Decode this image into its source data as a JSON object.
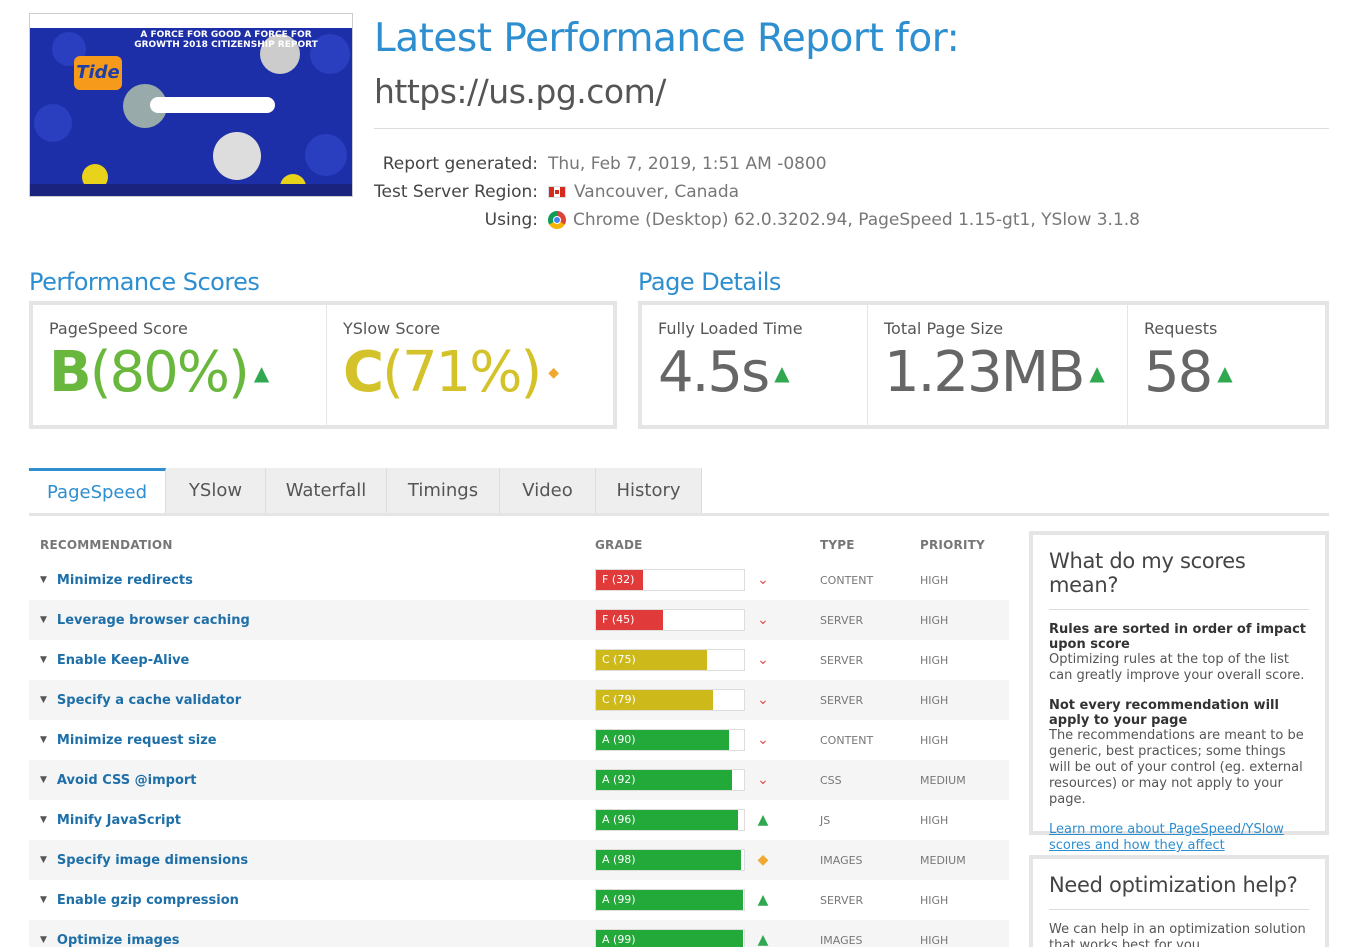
{
  "header": {
    "title": "Latest Performance Report for:",
    "url": "https://us.pg.com/",
    "meta": [
      {
        "label": "Report generated:",
        "value": "Thu, Feb 7, 2019, 1:51 AM -0800",
        "icon": ""
      },
      {
        "label": "Test Server Region:",
        "value": "Vancouver, Canada",
        "icon": "canada-flag-icon"
      },
      {
        "label": "Using:",
        "value": "Chrome (Desktop) 62.0.3202.94, PageSpeed 1.15-gt1, YSlow 3.1.8",
        "icon": "chrome-icon"
      }
    ],
    "thumbnail_text": "A FORCE FOR GOOD A FORCE FOR GROWTH 2018 CITIZENSHIP REPORT",
    "thumbnail_brand": "Tide"
  },
  "performance": {
    "title": "Performance Scores",
    "pagespeed": {
      "label": "PageSpeed Score",
      "grade": "B",
      "percent": "(80%)",
      "trend": "up"
    },
    "yslow": {
      "label": "YSlow Score",
      "grade": "C",
      "percent": "(71%)",
      "trend": "neutral"
    }
  },
  "details": {
    "title": "Page Details",
    "loaded": {
      "label": "Fully Loaded Time",
      "value": "4.5s"
    },
    "size": {
      "label": "Total Page Size",
      "value": "1.23MB"
    },
    "requests": {
      "label": "Requests",
      "value": "58"
    }
  },
  "tabs": [
    "PageSpeed",
    "YSlow",
    "Waterfall",
    "Timings",
    "Video",
    "History"
  ],
  "table": {
    "headers": {
      "rec": "RECOMMENDATION",
      "grade": "GRADE",
      "type": "TYPE",
      "priority": "PRIORITY"
    },
    "rows": [
      {
        "name": "Minimize redirects",
        "grade": "F (32)",
        "score": 32,
        "color": "#e03a3a",
        "trend": "down",
        "type": "CONTENT",
        "priority": "HIGH"
      },
      {
        "name": "Leverage browser caching",
        "grade": "F (45)",
        "score": 45,
        "color": "#e03a3a",
        "trend": "down",
        "type": "SERVER",
        "priority": "HIGH"
      },
      {
        "name": "Enable Keep-Alive",
        "grade": "C (75)",
        "score": 75,
        "color": "#cdb91a",
        "trend": "down",
        "type": "SERVER",
        "priority": "HIGH"
      },
      {
        "name": "Specify a cache validator",
        "grade": "C (79)",
        "score": 79,
        "color": "#cdb91a",
        "trend": "down",
        "type": "SERVER",
        "priority": "HIGH"
      },
      {
        "name": "Minimize request size",
        "grade": "A (90)",
        "score": 90,
        "color": "#23a93a",
        "trend": "down",
        "type": "CONTENT",
        "priority": "HIGH"
      },
      {
        "name": "Avoid CSS @import",
        "grade": "A (92)",
        "score": 92,
        "color": "#23a93a",
        "trend": "down",
        "type": "CSS",
        "priority": "MEDIUM"
      },
      {
        "name": "Minify JavaScript",
        "grade": "A (96)",
        "score": 96,
        "color": "#23a93a",
        "trend": "up",
        "type": "JS",
        "priority": "HIGH"
      },
      {
        "name": "Specify image dimensions",
        "grade": "A (98)",
        "score": 98,
        "color": "#23a93a",
        "trend": "neutral",
        "type": "IMAGES",
        "priority": "MEDIUM"
      },
      {
        "name": "Enable gzip compression",
        "grade": "A (99)",
        "score": 99,
        "color": "#23a93a",
        "trend": "up",
        "type": "SERVER",
        "priority": "HIGH"
      },
      {
        "name": "Optimize images",
        "grade": "A (99)",
        "score": 99,
        "color": "#23a93a",
        "trend": "up",
        "type": "IMAGES",
        "priority": "HIGH"
      }
    ]
  },
  "side1": {
    "title": "What do my scores mean?",
    "h1": "Rules are sorted in order of impact upon score",
    "p1": "Optimizing rules at the top of the list can greatly improve your overall score.",
    "h2": "Not every recommendation will apply to your page",
    "p2": "The recommendations are meant to be generic, best practices; some things will be out of your control (eg. external resources) or may not apply to your page.",
    "link": "Learn more about PageSpeed/YSlow scores and how they affect performance."
  },
  "side2": {
    "title": "Need optimization help?",
    "p1": "We can help in an optimization solution that works best for you."
  }
}
